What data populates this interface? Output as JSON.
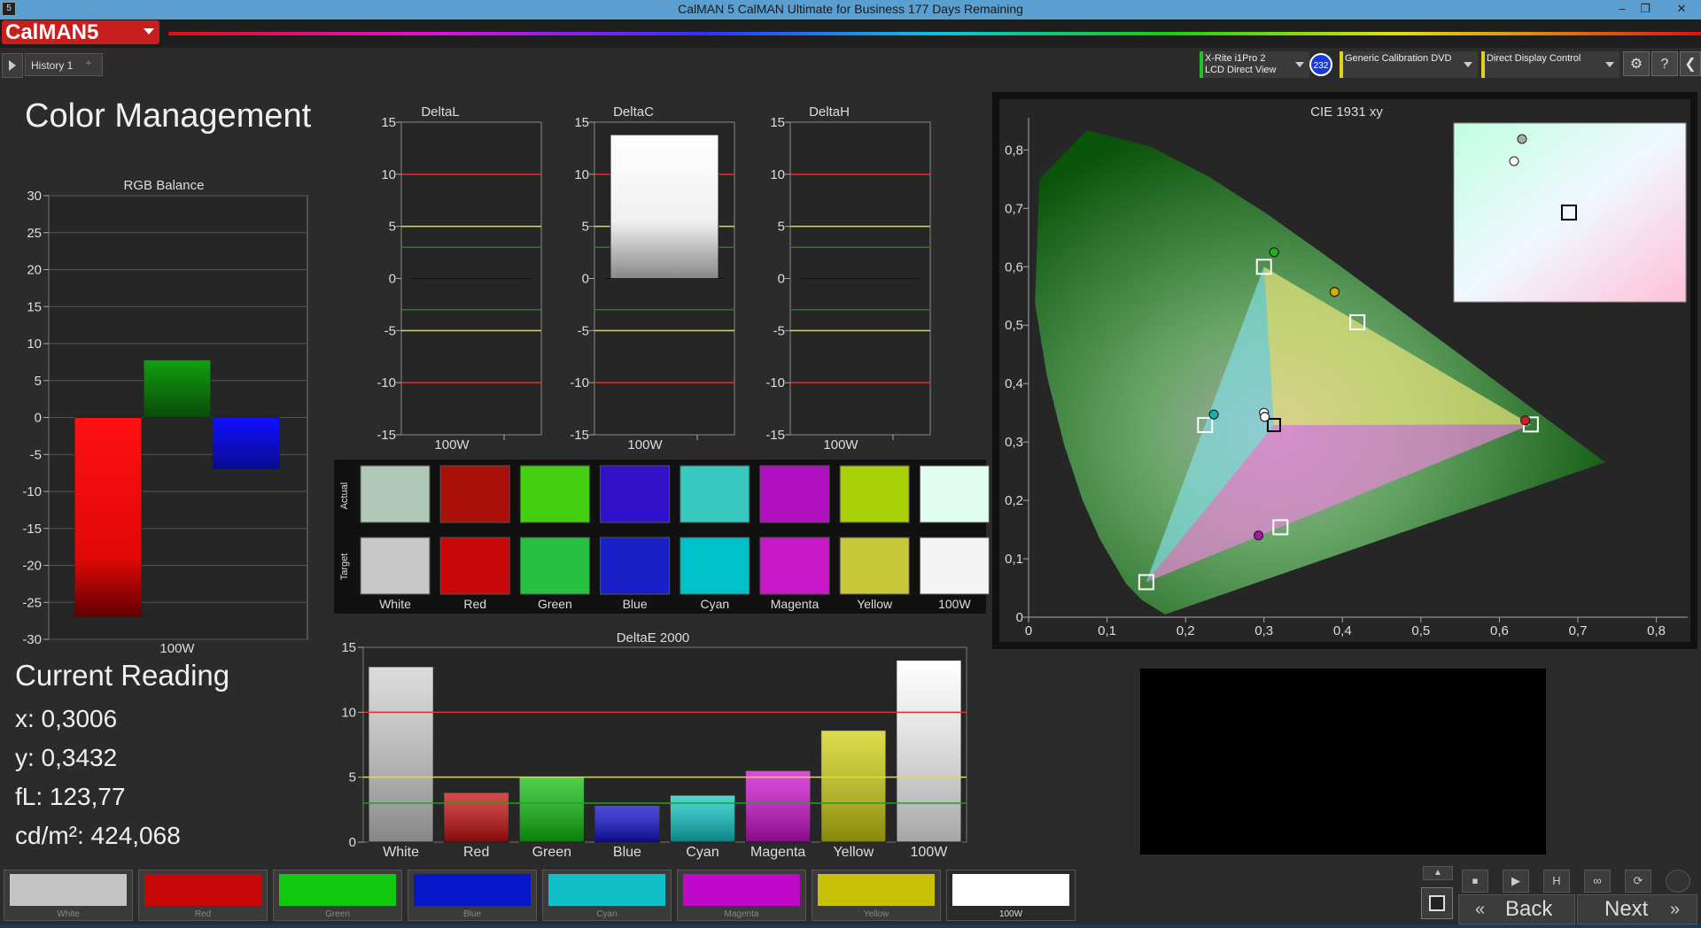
{
  "window": {
    "title": "CalMAN 5 CalMAN Ultimate for Business 177 Days Remaining",
    "app_icon": "5",
    "minimize": "–",
    "restore": "❐",
    "close": "✕"
  },
  "logo": "CalMAN5",
  "tabs": {
    "history": "History 1",
    "add": "+"
  },
  "devices": [
    {
      "line1": "X-Rite i1Pro 2",
      "line2": "LCD Direct View",
      "color": "#22c022"
    },
    {
      "line1": "Generic Calibration DVD",
      "line2": "",
      "color": "#e0d020"
    },
    {
      "line1": "Direct Display Control",
      "line2": "",
      "color": "#e0d020"
    }
  ],
  "meter_badge": "232",
  "toolbar_icons": [
    "gear-icon",
    "help-icon",
    "collapse-icon"
  ],
  "toolbar_glyphs": [
    "⚙",
    "?",
    "❮"
  ],
  "page_title": "Color Management",
  "rgb_balance": {
    "title": "RGB Balance",
    "xlabel": "100W",
    "ylim": [
      -30,
      30
    ],
    "ticks": [
      30,
      25,
      20,
      15,
      10,
      5,
      0,
      -5,
      -10,
      -15,
      -20,
      -25,
      -30
    ],
    "values": {
      "red": -27,
      "green": 7.8,
      "blue": -7
    }
  },
  "delta_charts": [
    {
      "title": "DeltaL",
      "value": 0,
      "xlabel": "100W"
    },
    {
      "title": "DeltaC",
      "value": 13.8,
      "xlabel": "100W"
    },
    {
      "title": "DeltaH",
      "value": 0,
      "xlabel": "100W"
    }
  ],
  "delta_ticks": [
    15,
    10,
    5,
    0,
    -5,
    -10,
    -15
  ],
  "swatches": {
    "actual_label": "Actual",
    "target_label": "Target",
    "items": [
      {
        "name": "White",
        "actual": "#b0c8b8",
        "target": "#c8c8c8"
      },
      {
        "name": "Red",
        "actual": "#a81008",
        "target": "#c80808"
      },
      {
        "name": "Green",
        "actual": "#44d010",
        "target": "#28c040"
      },
      {
        "name": "Blue",
        "actual": "#3010c8",
        "target": "#1a20c8"
      },
      {
        "name": "Cyan",
        "actual": "#38c8c0",
        "target": "#00c0c8"
      },
      {
        "name": "Magenta",
        "actual": "#b010c0",
        "target": "#c818c8"
      },
      {
        "name": "Yellow",
        "actual": "#a8d008",
        "target": "#c8c838"
      },
      {
        "name": "100W",
        "actual": "#e0fff0",
        "target": "#f4f4f4"
      }
    ]
  },
  "chart_data": [
    {
      "type": "bar",
      "title": "DeltaE 2000",
      "categories": [
        "White",
        "Red",
        "Green",
        "Blue",
        "Cyan",
        "Magenta",
        "Yellow",
        "100W"
      ],
      "values": [
        13.5,
        3.8,
        5.0,
        2.8,
        3.6,
        5.5,
        8.6,
        14.0
      ],
      "colors": [
        "#d0d0d0",
        "#c81010",
        "#10c010",
        "#1010d0",
        "#10c8c8",
        "#d010d0",
        "#d0d010",
        "#ffffff"
      ],
      "ylim": [
        0,
        15
      ],
      "yticks": [
        0,
        5,
        10,
        15
      ],
      "thresholds": [
        {
          "value": 10,
          "color": "#e03030"
        },
        {
          "value": 5,
          "color": "#e0e020"
        },
        {
          "value": 3,
          "color": "#20a020"
        }
      ]
    },
    {
      "type": "scatter",
      "title": "CIE 1931 xy",
      "xticks": [
        "0",
        "0,1",
        "0,2",
        "0,3",
        "0,4",
        "0,5",
        "0,6",
        "0,7",
        "0,8"
      ],
      "yticks": [
        "0",
        "0,1",
        "0,2",
        "0,3",
        "0,4",
        "0,5",
        "0,6",
        "0,7",
        "0,8"
      ],
      "xlim": [
        0,
        0.84
      ],
      "ylim": [
        0,
        0.84
      ],
      "targets": [
        [
          0.64,
          0.33
        ],
        [
          0.3,
          0.6
        ],
        [
          0.15,
          0.06
        ],
        [
          0.225,
          0.329
        ],
        [
          0.321,
          0.154
        ],
        [
          0.419,
          0.505
        ],
        [
          0.3127,
          0.329
        ]
      ],
      "measured": [
        [
          0.633,
          0.337
        ],
        [
          0.313,
          0.625
        ],
        [
          0.236,
          0.347
        ],
        [
          0.293,
          0.14
        ],
        [
          0.39,
          0.557
        ],
        [
          0.3,
          0.35
        ],
        [
          0.301,
          0.343
        ]
      ]
    }
  ],
  "reading": {
    "title": "Current Reading",
    "x": "x: 0,3006",
    "y": "y: 0,3432",
    "fl": "fL: 123,77",
    "cd": "cd/m²: 424,068"
  },
  "bottom_swatches": [
    {
      "label": "White",
      "color": "#c4c4c4"
    },
    {
      "label": "Red",
      "color": "#c80808"
    },
    {
      "label": "Green",
      "color": "#10c810"
    },
    {
      "label": "Blue",
      "color": "#0818c8"
    },
    {
      "label": "Cyan",
      "color": "#10c0c8"
    },
    {
      "label": "Magenta",
      "color": "#c008c8"
    },
    {
      "label": "Yellow",
      "color": "#c8c008"
    },
    {
      "label": "100W",
      "color": "#ffffff"
    }
  ],
  "nav": {
    "back": "Back",
    "next": "Next"
  },
  "controls": [
    "⏹",
    "▶",
    "H",
    "∞",
    "⟳"
  ]
}
